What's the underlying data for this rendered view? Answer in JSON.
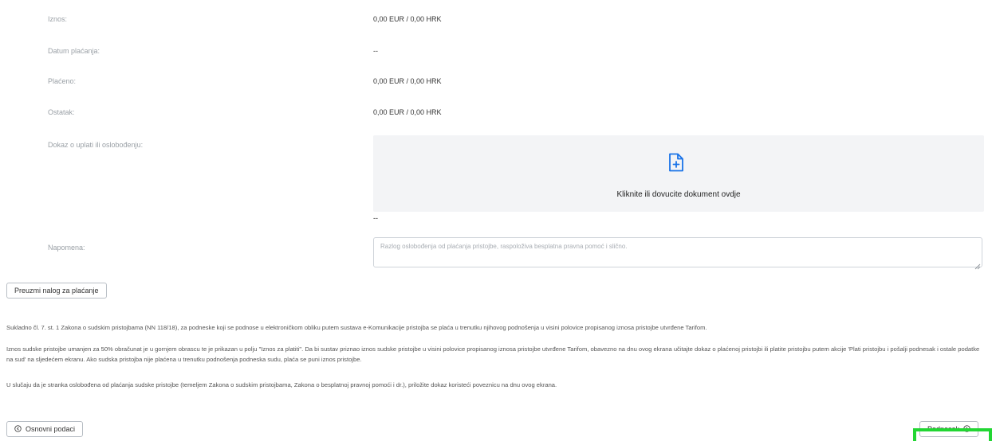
{
  "fields": [
    {
      "label": "Iznos:",
      "value": "0,00 EUR / 0,00 HRK"
    },
    {
      "label": "Datum plaćanja:",
      "value": "--"
    },
    {
      "label": "Plaćeno:",
      "value": "0,00 EUR / 0,00 HRK"
    },
    {
      "label": "Ostatak:",
      "value": "0,00 EUR / 0,00 HRK"
    }
  ],
  "proof": {
    "label": "Dokaz o uplati ili oslobođenju:",
    "dropzone_text": "Kliknite ili dovucite dokument ovdje",
    "value": "--",
    "icon": "file-plus-icon",
    "icon_color": "#1a73e8"
  },
  "note": {
    "label": "Napomena:",
    "placeholder": "Razlog oslobođenja od plaćanja pristojbe, raspoloživa besplatna pravna pomoć i slično.",
    "value": ""
  },
  "download_button": {
    "label": "Preuzmi nalog za plaćanje"
  },
  "paragraphs": [
    "Sukladno čl. 7. st. 1 Zakona o sudskim pristojbama (NN 118/18), za podneske koji se podnose u elektroničkom obliku putem sustava e-Komunikacije pristojba se plaća u trenutku njihovog podnošenja u visini polovice propisanog iznosa pristojbe utvrđene Tarifom.",
    "Iznos sudske pristojbe umanjen za 50% obračunat je u gornjem obrascu te je prikazan u polju \"Iznos za platiti\". Da bi sustav priznao iznos sudske pristojbe u visini polovice propisanog iznosa pristojbe utvrđene Tarifom, obavezno na dnu ovog ekrana učitajte dokaz o plaćenoj pristojbi ili platite pristojbu putem akcije 'Plati pristojbu i pošalji podnesak i ostale podatke na sud' na sljedećem ekranu. Ako sudska pristojba nije plaćena u trenutku podnošenja podneska sudu, plaća se puni iznos pristojbe.",
    "U slučaju da je stranka oslobođena od plaćanja sudske pristojbe (temeljem Zakona o sudskim pristojbama, Zakona o besplatnoj pravnoj pomoći i dr.), priložite dokaz koristeći poveznicu na dnu ovog ekrana."
  ],
  "nav": {
    "back_label": "Osnovni podaci",
    "back_icon": "arrow-left-circle-icon",
    "next_label": "Podnesak",
    "next_icon": "arrow-right-circle-icon"
  },
  "colors": {
    "highlight": "#22d633",
    "accent": "#1a73e8"
  }
}
